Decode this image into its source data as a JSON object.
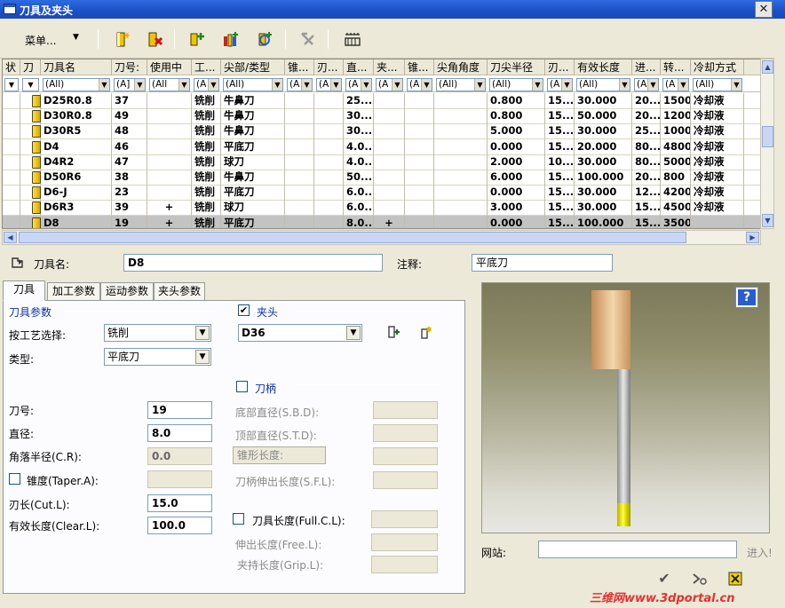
{
  "window": {
    "title": "刀具及夹头",
    "close": "✕"
  },
  "toolbar": {
    "menu_label": "菜单...",
    "menu_arrow": "▼"
  },
  "grid": {
    "columns": [
      "状",
      "刀",
      "刀具名",
      "刀号:",
      "使用中",
      "工...",
      "尖部/类型",
      "锥...",
      "刃...",
      "直...",
      "夹...",
      "锥...",
      "尖角角度",
      "刀尖半径",
      "刃...",
      "有效长度",
      "进...",
      "转...",
      "冷却方式"
    ],
    "filters": [
      "▼",
      "▼",
      "(All)",
      "(A]",
      "(All",
      "(A",
      "(All)",
      "(A",
      "(A",
      "(A",
      "(A",
      "(A",
      "(All)",
      "(All)",
      "(A",
      "(All)",
      "(A",
      "(A",
      "(All)"
    ],
    "rows": [
      {
        "name": "D25R0.8",
        "num": "37",
        "inuse": "",
        "op": "铣削",
        "type": "牛鼻刀",
        "dia": "25....",
        "holder": "",
        "radius": "0.800",
        "cut": "15....",
        "len": "30.000",
        "feed": "20...",
        "spin": "1500",
        "cool": "冷却液"
      },
      {
        "name": "D30R0.8",
        "num": "49",
        "inuse": "",
        "op": "铣削",
        "type": "牛鼻刀",
        "dia": "30....",
        "holder": "",
        "radius": "0.800",
        "cut": "15....",
        "len": "50.000",
        "feed": "20...",
        "spin": "1200",
        "cool": "冷却液"
      },
      {
        "name": "D30R5",
        "num": "48",
        "inuse": "",
        "op": "铣削",
        "type": "牛鼻刀",
        "dia": "30....",
        "holder": "",
        "radius": "5.000",
        "cut": "15....",
        "len": "30.000",
        "feed": "25...",
        "spin": "1000",
        "cool": "冷却液"
      },
      {
        "name": "D4",
        "num": "46",
        "inuse": "",
        "op": "铣削",
        "type": "平底刀",
        "dia": "4.0...",
        "holder": "",
        "radius": "0.000",
        "cut": "15....",
        "len": "20.000",
        "feed": "80...",
        "spin": "4800",
        "cool": "冷却液"
      },
      {
        "name": "D4R2",
        "num": "47",
        "inuse": "",
        "op": "铣削",
        "type": "球刀",
        "dia": "4.0...",
        "holder": "",
        "radius": "2.000",
        "cut": "10....",
        "len": "30.000",
        "feed": "80...",
        "spin": "5000",
        "cool": "冷却液"
      },
      {
        "name": "D50R6",
        "num": "38",
        "inuse": "",
        "op": "铣削",
        "type": "牛鼻刀",
        "dia": "50....",
        "holder": "",
        "radius": "6.000",
        "cut": "15....",
        "len": "100.000",
        "feed": "20...",
        "spin": "800",
        "cool": "冷却液"
      },
      {
        "name": "D6-J",
        "num": "23",
        "inuse": "",
        "op": "铣削",
        "type": "平底刀",
        "dia": "6.0...",
        "holder": "",
        "radius": "0.000",
        "cut": "15....",
        "len": "30.000",
        "feed": "12...",
        "spin": "4200",
        "cool": "冷却液"
      },
      {
        "name": "D6R3",
        "num": "39",
        "inuse": "+",
        "op": "铣削",
        "type": "球刀",
        "dia": "6.0...",
        "holder": "",
        "radius": "3.000",
        "cut": "15....",
        "len": "30.000",
        "feed": "15...",
        "spin": "4500",
        "cool": "冷却液"
      },
      {
        "name": "D8",
        "num": "19",
        "inuse": "+",
        "op": "铣削",
        "type": "平底刀",
        "dia": "8.0...",
        "holder": "+",
        "radius": "0.000",
        "cut": "15....",
        "len": "100.000",
        "feed": "15...",
        "spin": "3500",
        "cool": ""
      }
    ]
  },
  "detail": {
    "name_label": "刀具名:",
    "name_value": "D8",
    "note_label": "注释:",
    "note_value": "平底刀",
    "tabs": [
      "刀具",
      "加工参数",
      "运动参数",
      "夹头参数"
    ],
    "tool_params_title": "刀具参数",
    "process_label": "按工艺选择:",
    "process_value": "铣削",
    "type_label": "类型:",
    "type_value": "平底刀",
    "num_label": "刀号:",
    "num_value": "19",
    "dia_label": "直径:",
    "dia_value": "8.0",
    "cr_label": "角落半径(C.R):",
    "cr_value": "0.0",
    "taper_label": "锥度(Taper.A):",
    "cut_label": "刃长(Cut.L):",
    "cut_value": "15.0",
    "clear_label": "有效长度(Clear.L):",
    "clear_value": "100.0",
    "holder_title": "夹头",
    "holder_value": "D36",
    "shank_title": "刀柄",
    "sbd_label": "底部直径(S.B.D):",
    "std_label": "顶部直径(S.T.D):",
    "taperlen_label": "锥形长度:",
    "sfl_label": "刀柄伸出长度(S.F.L):",
    "fullcl_label": "刀具长度(Full.C.L):",
    "free_label": "伸出长度(Free.L):",
    "grip_label": "夹持长度(Grip.L):",
    "website_label": "网站:",
    "enter_label": "进入!",
    "help": "?",
    "watermark": "三维网www.3dportal.cn"
  }
}
